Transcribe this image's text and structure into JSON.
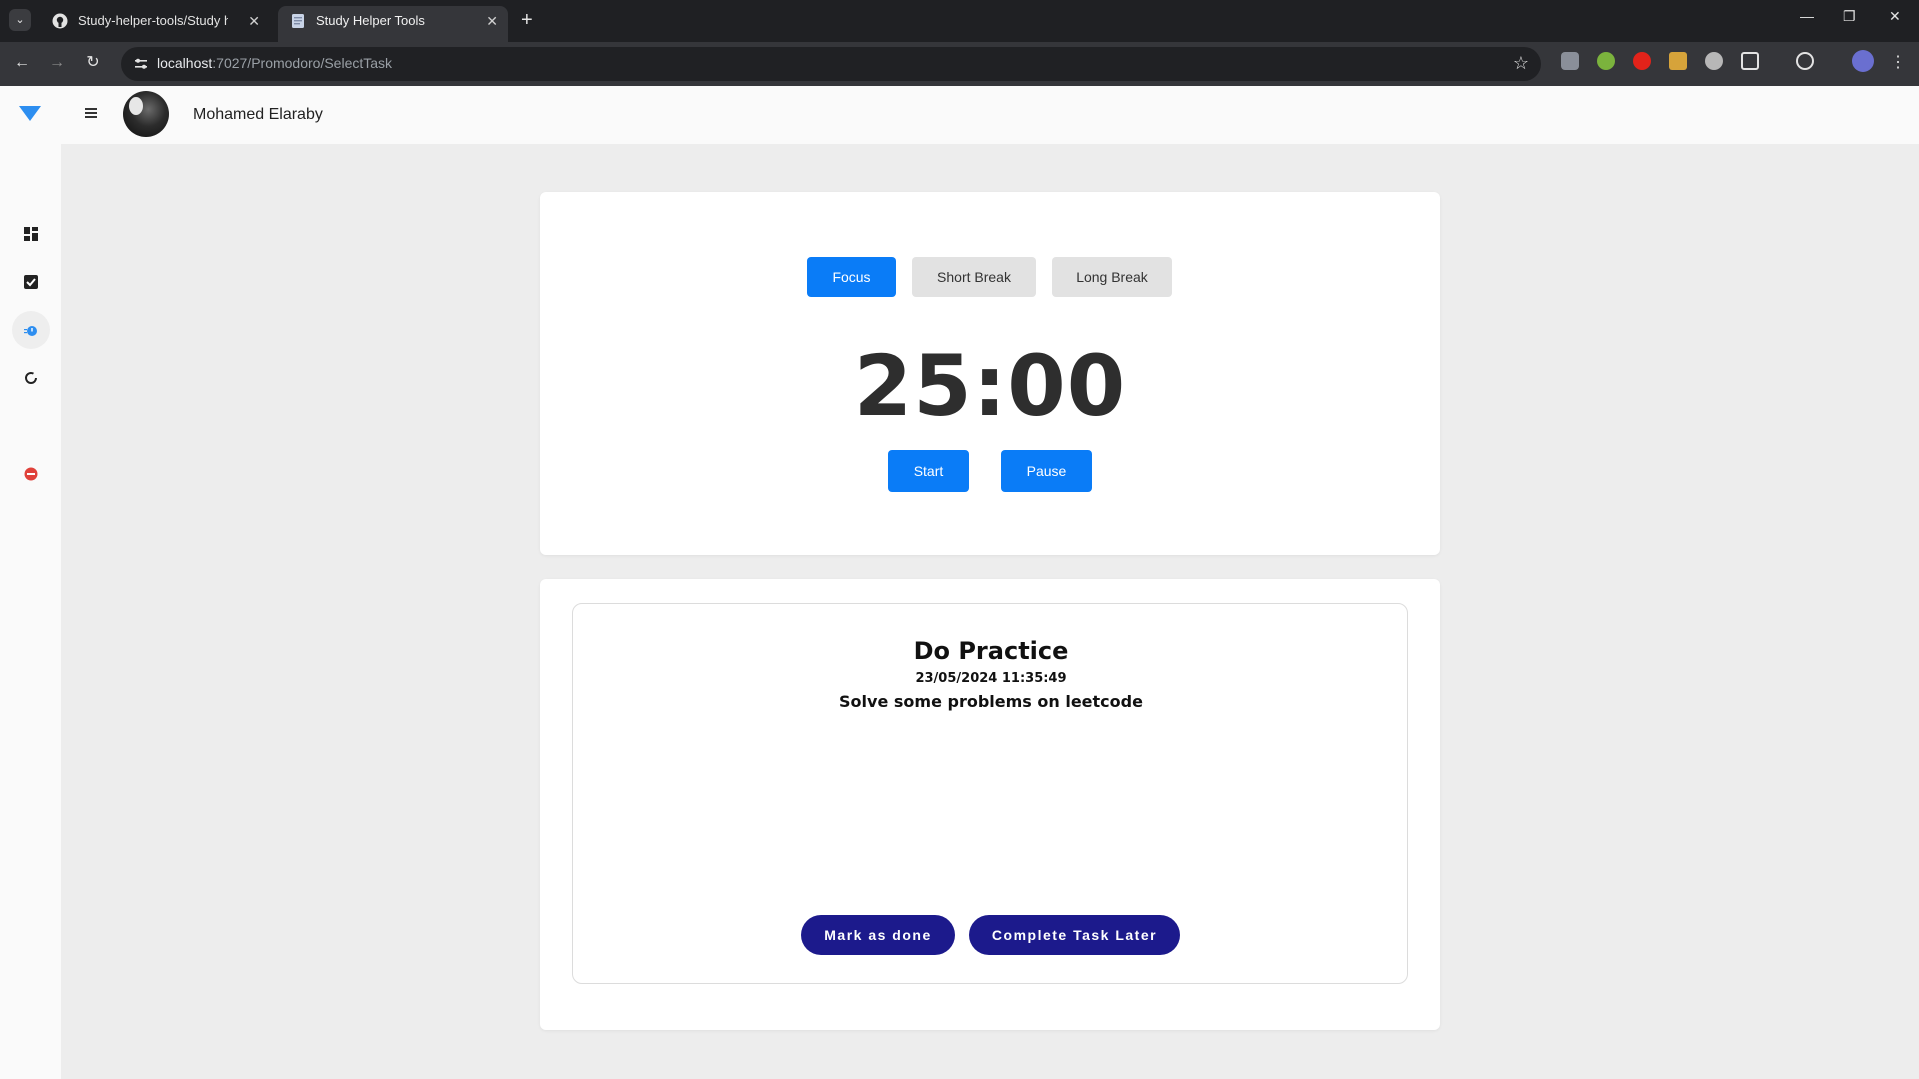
{
  "browser": {
    "tabs": [
      {
        "title": "Study-helper-tools/Study helpe",
        "icon": "github-icon",
        "active": false
      },
      {
        "title": "Study Helper Tools",
        "icon": "page-icon",
        "active": true
      }
    ],
    "url_host": "localhost",
    "url_path": ":7027/Promodoro/SelectTask"
  },
  "header": {
    "user_name": "Mohamed Elaraby"
  },
  "sidebar": {
    "items": [
      {
        "icon": "dashboard-icon"
      },
      {
        "icon": "checkbox-icon"
      },
      {
        "icon": "timer-icon",
        "active": true
      },
      {
        "icon": "refresh-icon"
      },
      {
        "icon": "logout-icon"
      }
    ]
  },
  "timer": {
    "modes": [
      "Focus",
      "Short Break",
      "Long Break"
    ],
    "active_mode": "Focus",
    "time": "25:00",
    "start_label": "Start",
    "pause_label": "Pause"
  },
  "task": {
    "title": "Do Practice",
    "date": "23/05/2024 11:35:49",
    "description": "Solve some problems on leetcode",
    "done_label": "Mark as done",
    "later_label": "Complete Task Later"
  },
  "colors": {
    "primary": "#0a7cf7",
    "task_button": "#1c1a8c",
    "background": "#ededed"
  }
}
